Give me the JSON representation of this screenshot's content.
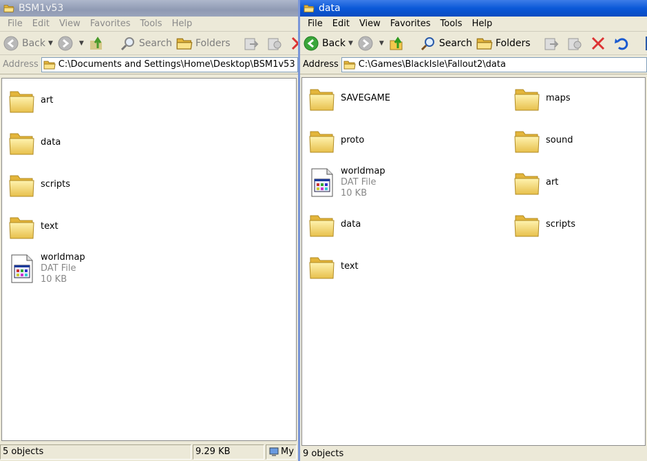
{
  "left": {
    "title": "BSM1v53",
    "menu": [
      "File",
      "Edit",
      "View",
      "Favorites",
      "Tools",
      "Help"
    ],
    "toolbar": {
      "back": "Back",
      "search": "Search",
      "folders": "Folders"
    },
    "address_label": "Address",
    "address": "C:\\Documents and Settings\\Home\\Desktop\\BSM1v53",
    "items": [
      {
        "name": "art"
      },
      {
        "name": "data"
      },
      {
        "name": "scripts"
      },
      {
        "name": "text"
      },
      {
        "name": "worldmap",
        "type": "DAT File",
        "size": "10 KB"
      }
    ],
    "status": {
      "objects": "5 objects",
      "size": "9.29 KB",
      "zone": "My"
    }
  },
  "right": {
    "title": "data",
    "menu": [
      "File",
      "Edit",
      "View",
      "Favorites",
      "Tools",
      "Help"
    ],
    "toolbar": {
      "back": "Back",
      "search": "Search",
      "folders": "Folders"
    },
    "address_label": "Address",
    "address": "C:\\Games\\BlackIsle\\Fallout2\\data",
    "items_col1": [
      {
        "name": "SAVEGAME"
      },
      {
        "name": "proto"
      },
      {
        "name": "worldmap",
        "type": "DAT File",
        "size": "10 KB"
      },
      {
        "name": "data"
      },
      {
        "name": "text"
      }
    ],
    "items_col2": [
      {
        "name": "maps"
      },
      {
        "name": "sound"
      },
      {
        "name": "art"
      },
      {
        "name": "scripts"
      }
    ],
    "status": {
      "objects": "9 objects"
    }
  }
}
